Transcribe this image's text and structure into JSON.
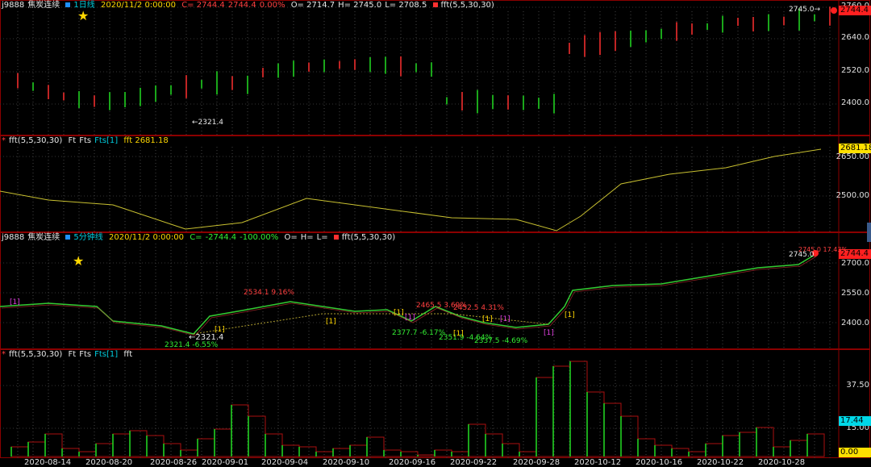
{
  "pane1": {
    "symbol": "j9888",
    "name": "焦炭连续",
    "period": "1日线",
    "datetime": "2020/11/2 0:00:00",
    "close": "C= 2744.4",
    "last": "2744.4",
    "change": "0.00%",
    "open": "O= 2714.7",
    "high": "H= 2745.0",
    "low": "L= 2708.5",
    "indicator": "fft(5,5,30,30)",
    "axis": [
      "2760.0",
      "2640.0",
      "2520.0",
      "2400.0"
    ],
    "price_tag": "2744.4",
    "high_mark": "2745.0→",
    "low_mark": "←2321.4",
    "colors": {
      "up": "#ff3030",
      "down": "#22dd22"
    }
  },
  "pane2": {
    "indicator": "fft(5,5,30,30)",
    "ft": "Ft",
    "fts": "Fts",
    "fts1": "Fts[1]",
    "value_label": "fft 2681.18",
    "axis": [
      "2650.00",
      "2500.00"
    ],
    "tag": "2681.18",
    "color": "#c8c030"
  },
  "pane3": {
    "symbol": "j9888",
    "name": "焦炭连续",
    "period": "5分钟线",
    "datetime": "2020/11/2 0:00:00",
    "close": "C=",
    "close_val": "-2744.4",
    "change": "-100.00%",
    "open": "O=",
    "high": "H=",
    "low": "L=",
    "indicator": "fft(5,5,30,30)",
    "axis": [
      "2700.0",
      "2550.0",
      "2400.0"
    ],
    "price_tag": "2744.4",
    "high_mark": "2745.0",
    "high_pct": "2745.0 17.43%",
    "annotations": [
      {
        "text": "2534.1 9.16%",
        "color": "#ff4040"
      },
      {
        "text": "2465.5 3.69%",
        "color": "#ff4040"
      },
      {
        "text": "2452.5 4.31%",
        "color": "#ff4040"
      },
      {
        "text": "2321.4 -6.55%",
        "color": "#33ee33"
      },
      {
        "text": "2377.7 -6.17%",
        "color": "#33ee33"
      },
      {
        "text": "2351.9 -4.64%",
        "color": "#33ee33"
      },
      {
        "text": "2337.5 -4.69%",
        "color": "#33ee33"
      },
      {
        "text": "←2321.4",
        "color": "#ffffff"
      }
    ],
    "marker": "[1]"
  },
  "pane4": {
    "indicator": "fft(5,5,30,30)",
    "ft": "Ft",
    "fts": "Fts",
    "fts1": "Fts[1]",
    "value_label": "fft",
    "axis": [
      "37.50",
      "15.00"
    ],
    "tag": "17.44",
    "tag2": "0.00"
  },
  "x_axis": [
    "2020-08-14",
    "2020-08-20",
    "2020-08-26",
    "2020-09-01",
    "2020-09-04",
    "2020-09-10",
    "2020-09-16",
    "2020-09-22",
    "2020-09-28",
    "2020-10-12",
    "2020-10-16",
    "2020-10-22",
    "2020-10-28"
  ]
}
